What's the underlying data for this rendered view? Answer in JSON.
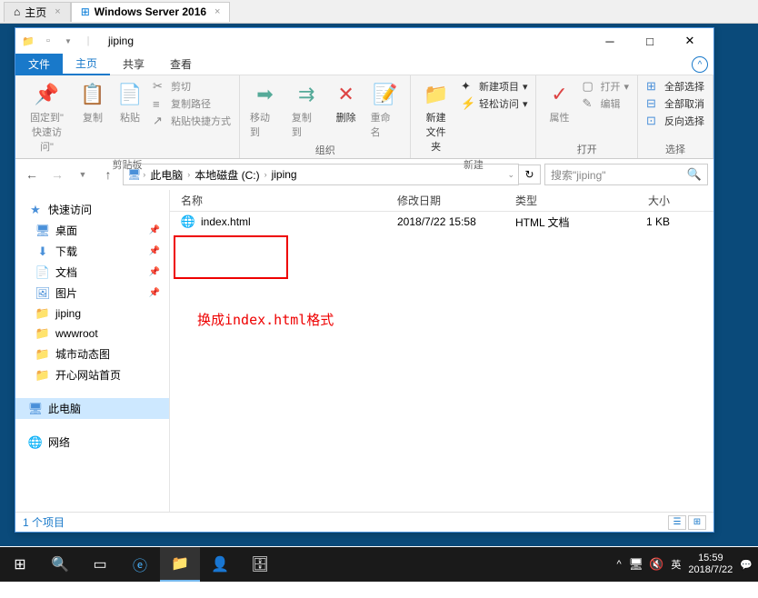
{
  "browserTabs": {
    "tab1": "主页",
    "tab2": "Windows Server 2016"
  },
  "titlebar": {
    "title": "jiping"
  },
  "ribbonTabs": {
    "file": "文件",
    "home": "主页",
    "share": "共享",
    "view": "查看"
  },
  "ribbon": {
    "pinTo": "固定到\"\n快速访问\"",
    "copy": "复制",
    "paste": "粘贴",
    "cut": "剪切",
    "copyPath": "复制路径",
    "pasteShortcut": "粘贴快捷方式",
    "clipboard": "剪贴板",
    "moveTo": "移动到",
    "copyTo": "复制到",
    "delete": "删除",
    "rename": "重命名",
    "organize": "组织",
    "newFolder": "新建\n文件夹",
    "newItem": "新建项目",
    "easyAccess": "轻松访问",
    "new": "新建",
    "properties": "属性",
    "open": "打开",
    "edit": "编辑",
    "openGroup": "打开",
    "selectAll": "全部选择",
    "selectNone": "全部取消",
    "invertSel": "反向选择",
    "select": "选择"
  },
  "breadcrumb": {
    "pc": "此电脑",
    "drive": "本地磁盘 (C:)",
    "folder": "jiping"
  },
  "search": {
    "placeholder": "搜索\"jiping\""
  },
  "sidebar": {
    "quickAccess": "快速访问",
    "desktop": "桌面",
    "downloads": "下载",
    "documents": "文档",
    "pictures": "图片",
    "jiping": "jiping",
    "wwwroot": "wwwroot",
    "cityDynamic": "城市动态图",
    "happySite": "开心网站首页",
    "thisPC": "此电脑",
    "network": "网络"
  },
  "columns": {
    "name": "名称",
    "date": "修改日期",
    "type": "类型",
    "size": "大小"
  },
  "files": [
    {
      "name": "index.html",
      "date": "2018/7/22 15:58",
      "type": "HTML 文档",
      "size": "1 KB"
    }
  ],
  "annotation": "换成index.html格式",
  "statusbar": {
    "items": "1 个项目"
  },
  "taskbar": {
    "ime": "英",
    "time": "15:59",
    "date": "2018/7/22"
  }
}
